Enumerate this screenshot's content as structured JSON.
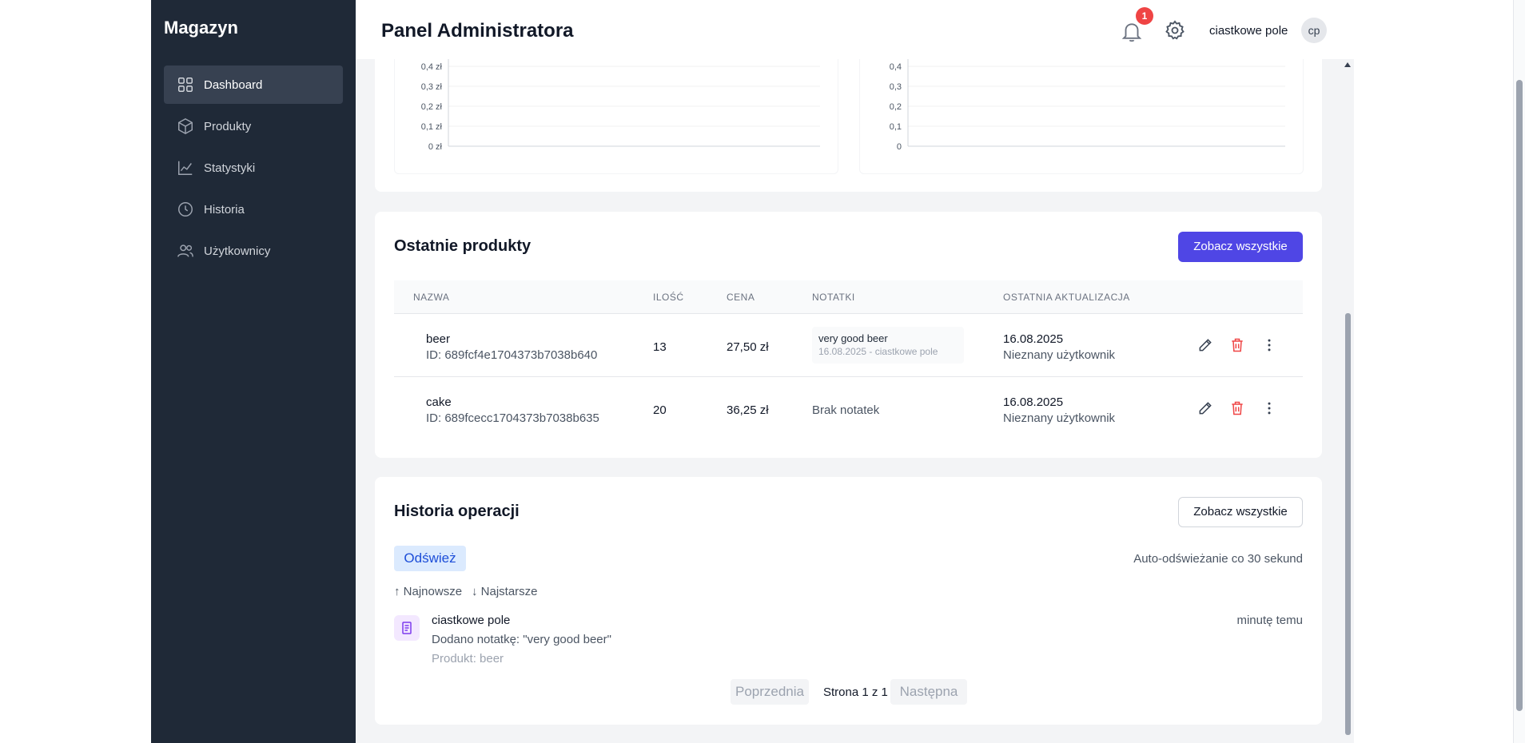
{
  "app": {
    "brand": "Magazyn",
    "page_title": "Panel Administratora"
  },
  "sidebar": {
    "items": [
      {
        "label": "Dashboard",
        "icon": "grid-icon",
        "active": true
      },
      {
        "label": "Produkty",
        "icon": "box-icon"
      },
      {
        "label": "Statystyki",
        "icon": "chart-line-icon"
      },
      {
        "label": "Historia",
        "icon": "clock-icon"
      },
      {
        "label": "Użytkownicy",
        "icon": "users-icon"
      }
    ]
  },
  "header": {
    "notification_count": "1",
    "user_name": "ciastkowe pole",
    "avatar_initials": "cp"
  },
  "charts": {
    "left_ticks": [
      "0,4 zł",
      "0,3 zł",
      "0,2 zł",
      "0,1 zł",
      "0 zł"
    ],
    "right_ticks": [
      "0,4",
      "0,3",
      "0,2",
      "0,1",
      "0"
    ]
  },
  "chart_data": [
    {
      "type": "line",
      "title": "",
      "xlabel": "",
      "ylabel": "",
      "ylim": [
        0,
        0.4
      ],
      "y_ticks": [
        "0,4 zł",
        "0,3 zł",
        "0,2 zł",
        "0,1 zł",
        "0 zł"
      ],
      "grid": true,
      "series": []
    },
    {
      "type": "line",
      "title": "",
      "xlabel": "",
      "ylabel": "",
      "ylim": [
        0,
        0.4
      ],
      "y_ticks": [
        "0,4",
        "0,3",
        "0,2",
        "0,1",
        "0"
      ],
      "grid": true,
      "series": []
    }
  ],
  "products": {
    "title": "Ostatnie produkty",
    "see_all": "Zobacz wszystkie",
    "columns": [
      "NAZWA",
      "ILOŚĆ",
      "CENA",
      "NOTATKI",
      "OSTATNIA AKTUALIZACJA"
    ],
    "rows": [
      {
        "name": "beer",
        "id": "ID: 689fcf4e1704373b7038b640",
        "qty": "13",
        "price": "27,50 zł",
        "note": "very good beer",
        "note_meta": "16.08.2025 - ciastkowe pole",
        "date": "16.08.2025",
        "updated_by": "Nieznany użytkownik"
      },
      {
        "name": "cake",
        "id": "ID: 689fcecc1704373b7038b635",
        "qty": "20",
        "price": "36,25 zł",
        "note": "Brak notatek",
        "date": "16.08.2025",
        "updated_by": "Nieznany użytkownik"
      }
    ]
  },
  "history": {
    "title": "Historia operacji",
    "see_all": "Zobacz wszystkie",
    "refresh": "Odśwież",
    "auto_refresh": "Auto-odświeżanie co 30 sekund",
    "sort_newest": "↑ Najnowsze",
    "sort_oldest": "↓ Najstarsze",
    "entries": [
      {
        "user": "ciastkowe pole",
        "description": "Dodano notatkę: \"very good beer\"",
        "product": "Produkt: beer",
        "time": "minutę temu"
      }
    ],
    "pagination": {
      "prev": "Poprzednia",
      "info": "Strona 1 z 1",
      "next": "Następna"
    }
  }
}
